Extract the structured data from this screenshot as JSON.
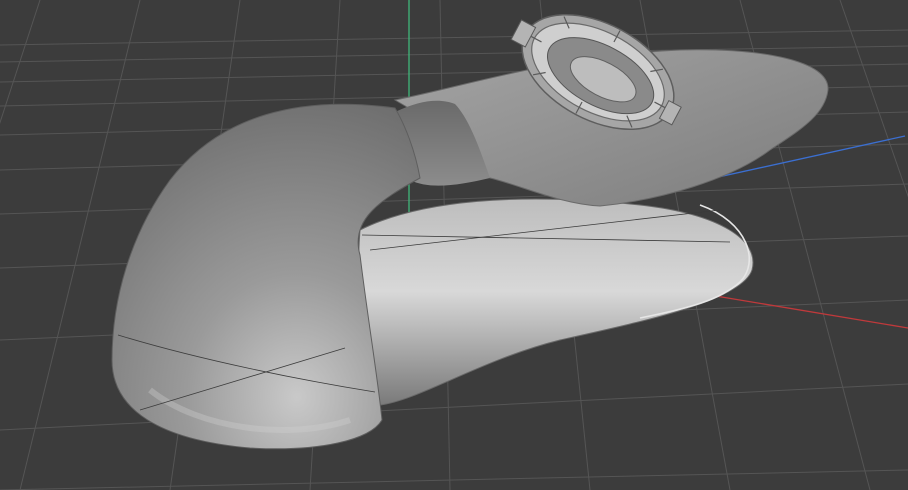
{
  "viewport": {
    "background_color": "#3c3c3c",
    "grid_color": "#555555",
    "axis_colors": {
      "x": "#c0393b",
      "y": "#3fb87a",
      "z": "#3b6fd1"
    },
    "model_color": "#8d8d8d",
    "objects": [
      "engine-nacelle-model",
      "turbine-fan-model"
    ]
  }
}
